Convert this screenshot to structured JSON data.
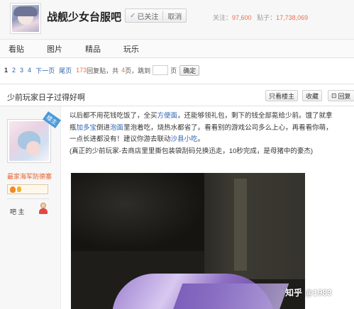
{
  "header": {
    "forum_name": "战舰少女台服吧",
    "follow_label": "已关注",
    "unfollow_label": "取消",
    "stats_follow_label": "关注：",
    "stats_follow_value": "97,600",
    "stats_posts_label": "贴子：",
    "stats_posts_value": "17,738,069"
  },
  "nav": {
    "items": [
      "看贴",
      "图片",
      "精品",
      "玩乐"
    ]
  },
  "pager": {
    "pages": [
      "1",
      "2",
      "3",
      "4"
    ],
    "next_label": "下一页",
    "last_label": "尾页",
    "reply_count": "173",
    "reply_suffix": "回复贴，共",
    "page_total": "4",
    "page_suffix": "页，跳到",
    "page_unit": "页",
    "confirm_label": "确定"
  },
  "thread": {
    "title": "少前玩家日子过得好啊",
    "only_op_label": "只看楼主",
    "favorite_label": "收藏",
    "reply_label": "回复"
  },
  "post": {
    "author_badge": "楼主",
    "author_name": "最家海军防德塞",
    "role": "吧 主",
    "text_1": "以后都不用花钱吃饭了，全买",
    "link_1": "方便面",
    "text_2": "，还能够领礼包，剩下的钱全部氪给少前。饿了就拿瓶",
    "link_2": "加多宝",
    "text_3": "倒进",
    "link_3": "泡面",
    "text_4": "里泡着吃，烧热水都省了。看看别的游戏公司多么上心，再看看你萌，一点长进都没有！建议你游去联动",
    "link_4": "沙县小吃",
    "text_5": "。",
    "note": "(真正的少前玩家-去商店里里撕包装袋刮码兑换迅走，10秒完成，是母猪中的豪杰)"
  },
  "watermark": "知乎 @1983"
}
